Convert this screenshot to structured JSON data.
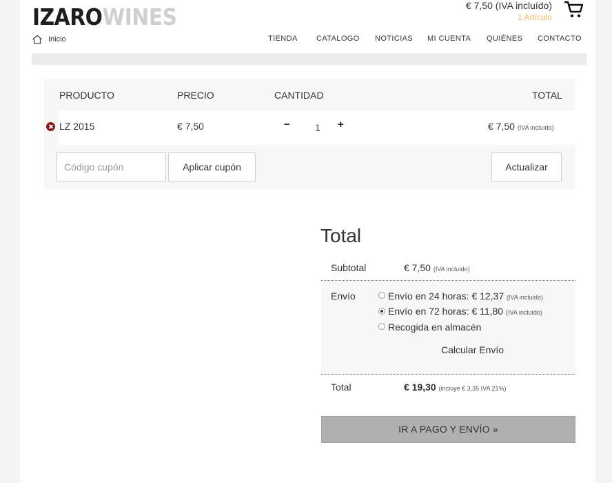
{
  "header": {
    "logo_part1": "IZARO",
    "logo_part2": "WINES",
    "cart_total": "€  7,50 (IVA incluído)",
    "cart_count": "1 Artículo",
    "breadcrumb": "Inicio"
  },
  "nav": [
    "TIENDA",
    "CATALOGO",
    "NOTICIAS",
    "MI CUENTA",
    "QUIÉNES",
    "CONTACTO"
  ],
  "cart": {
    "headers": {
      "product": "PRODUCTO",
      "price": "PRECIO",
      "quantity": "CANTIDAD",
      "total": "TOTAL"
    },
    "item": {
      "name": "LZ 2015",
      "price": "€  7,50",
      "qty_minus": "−",
      "quantity": "1",
      "qty_plus": "+",
      "total": "€  7,50",
      "total_note": "(IVA incluído)"
    },
    "coupon_placeholder": "Código cupón",
    "apply_coupon": "Aplicar cupón",
    "update": "Actualizar"
  },
  "totals": {
    "title": "Total",
    "subtotal_label": "Subtotal",
    "subtotal_value": "€  7,50",
    "subtotal_note": "(IVA incluído)",
    "shipping_label": "Envío",
    "shipping_options": [
      {
        "text": "Envío en 24 horas: €  12,37",
        "note": "(IVA incluído)",
        "selected": false
      },
      {
        "text": "Envío en 72 horas: €  11,80",
        "note": "(IVA incluído)",
        "selected": true
      },
      {
        "text": "Recogida en almacén",
        "note": "",
        "selected": false
      }
    ],
    "calc_shipping": "Calcular Envío",
    "total_label": "Total",
    "total_value": "€  19,30",
    "total_note": "(incluye €  3,35 IVA 21%)",
    "checkout": "IR A PAGO Y ENVÍO  »"
  }
}
